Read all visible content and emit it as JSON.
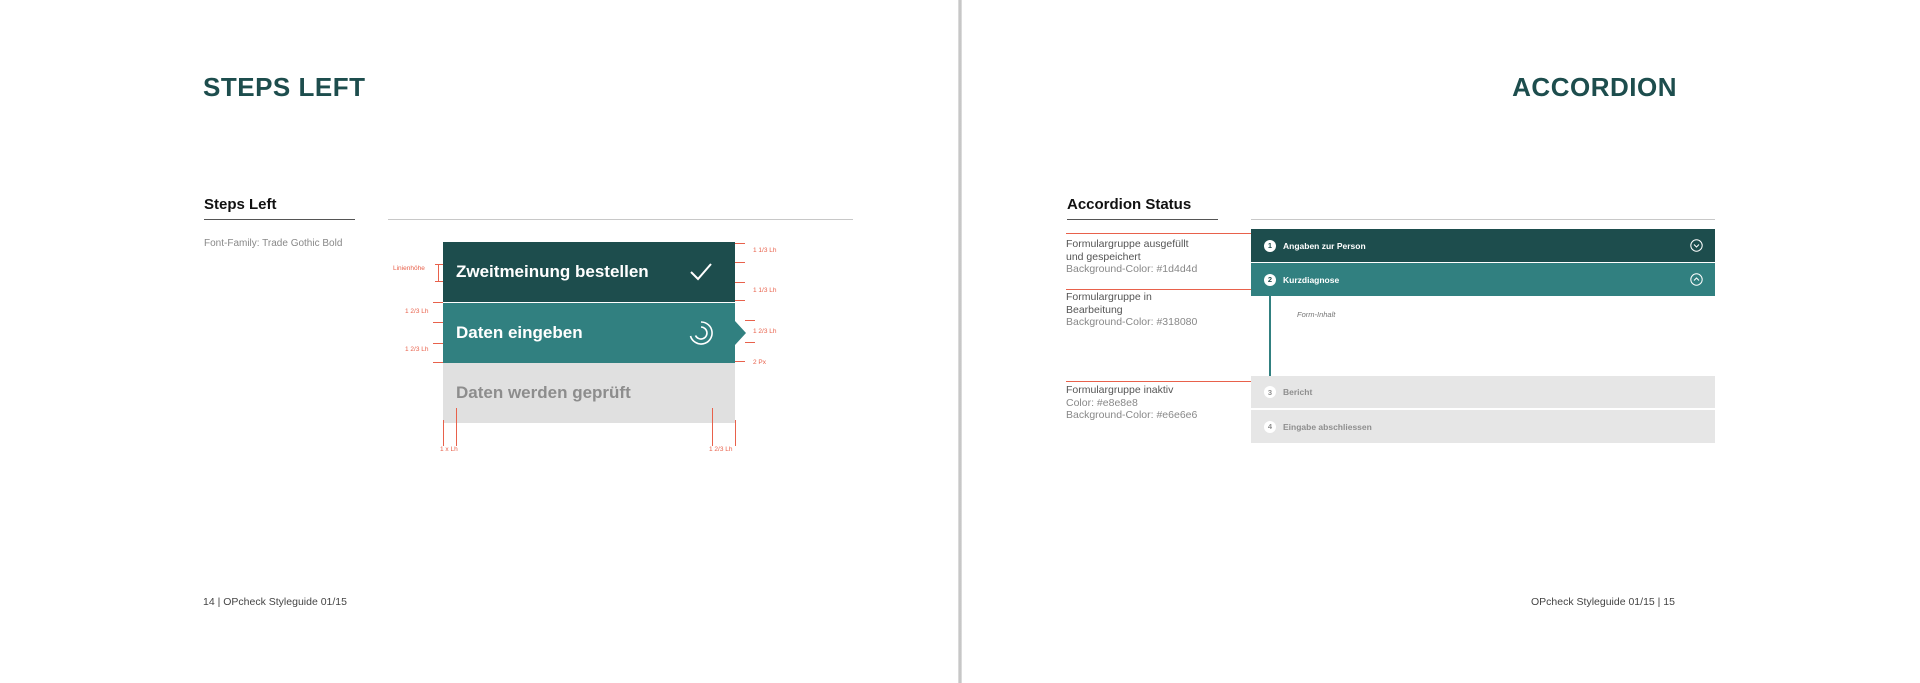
{
  "left_page": {
    "title": "STEPS LEFT",
    "section_title": "Steps Left",
    "font_note": "Font-Family: Trade Gothic Bold",
    "steps": [
      {
        "label": "Zweitmeinung bestellen",
        "state": "done",
        "icon": "check-icon"
      },
      {
        "label": "Daten eingeben",
        "state": "active",
        "icon": "progress-spinner-icon"
      },
      {
        "label": "Daten werden geprüft",
        "state": "inactive"
      }
    ],
    "measures": {
      "zeilenhoehe": "Linienhöhe",
      "top_right_1": "1 1/3 Lh",
      "top_right_2": "1 1/3 Lh",
      "left_mid_1": "1 2/3 Lh",
      "left_mid_2": "1 2/3 Lh",
      "right_mid": "1 2/3 Lh",
      "right_gap": "2 Px",
      "bottom_left": "1 x Lh",
      "bottom_right": "1 2/3  Lh"
    },
    "footer": "14 | OPcheck Styleguide 01/15"
  },
  "right_page": {
    "title": "ACCORDION",
    "section_title": "Accordion Status",
    "descriptions": [
      {
        "line1": "Formulargruppe ausgefüllt",
        "line2": "und gespeichert",
        "line3": "Background-Color: #1d4d4d"
      },
      {
        "line1": "Formulargruppe in",
        "line2": "Bearbeitung",
        "line3": "Background-Color: #318080"
      },
      {
        "line1": "Formulargruppe inaktiv",
        "line2": "Color: #e8e8e8",
        "line3": "Background-Color: #e6e6e6"
      }
    ],
    "accordion": [
      {
        "num": "1",
        "label": "Angaben zur Person",
        "state": "done",
        "icon": "chevron-down-circle-icon"
      },
      {
        "num": "2",
        "label": "Kurzdiagnose",
        "state": "active",
        "icon": "chevron-up-circle-icon"
      },
      {
        "num": "3",
        "label": "Bericht",
        "state": "inactive"
      },
      {
        "num": "4",
        "label": "Eingabe abschliessen",
        "state": "inactive"
      }
    ],
    "form_content": "Form-Inhalt",
    "footer": "OPcheck Styleguide 01/15  |  15"
  },
  "colors": {
    "done": "#1d4d4d",
    "active": "#318080",
    "inactive_bg": "#e6e6e6",
    "inactive_text": "#8e8e8e",
    "measure_red": "#e8614b"
  }
}
